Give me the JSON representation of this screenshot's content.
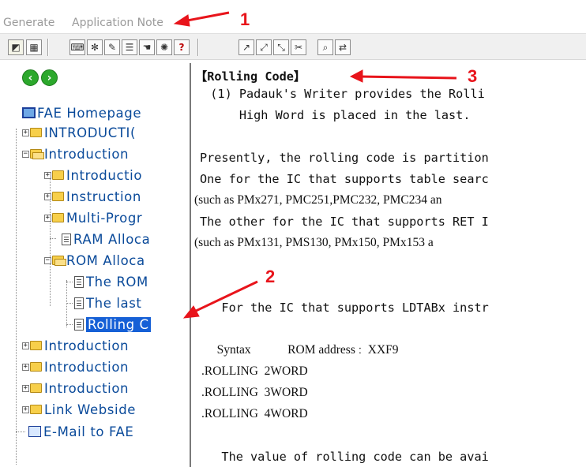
{
  "menu": {
    "generate": "Generate",
    "application_note": "Application Note"
  },
  "toolbar": {
    "buttons": [
      "toolbar-compile",
      "toolbar-debug",
      "toolbar-keyboard",
      "toolbar-settings",
      "toolbar-list",
      "toolbar-hand",
      "toolbar-wheel",
      "toolbar-help",
      "toolbar-tool1",
      "toolbar-tool2",
      "toolbar-tool3",
      "toolbar-tool4",
      "toolbar-find",
      "toolbar-replace"
    ],
    "help_glyph": "?"
  },
  "tree": {
    "root": "FAE Homepage",
    "items": [
      {
        "label": "INTRODUCTI("
      },
      {
        "label": "Introduction"
      },
      {
        "label": "Introductio"
      },
      {
        "label": "Instruction"
      },
      {
        "label": "Multi-Progr"
      },
      {
        "label": "RAM Alloca"
      },
      {
        "label": "ROM Alloca"
      },
      {
        "label": "The ROM"
      },
      {
        "label": "The last"
      },
      {
        "label": "Rolling C"
      },
      {
        "label": "Introduction"
      },
      {
        "label": "Introduction"
      },
      {
        "label": "Introduction"
      },
      {
        "label": "Link Webside"
      },
      {
        "label": "E-Mail to FAE"
      }
    ]
  },
  "content": {
    "heading": "【Rolling Code】",
    "lines": [
      "  (1) Padauk's Writer provides the Rolli",
      "      High Word is placed in the last.",
      "",
      "Presently, the rolling code is partition",
      "One for the IC that supports table searc",
      "(such as PMx271, PMC251,PMC232, PMC234 an",
      "The other for the IC that supports RET I",
      "(such as PMx131, PMS130, PMx150, PMx153 a",
      "",
      "",
      "   For the IC that supports LDTABx instr",
      "",
      "   Syntax            ROM address ː  XXF9",
      ".ROLLING  2WORD",
      ".ROLLING  3WORD",
      ".ROLLING  4WORD",
      "",
      "   The value of rolling code can be avai"
    ]
  },
  "annotations": {
    "one": "1",
    "two": "2",
    "three": "3",
    "color": "#e8141b"
  }
}
